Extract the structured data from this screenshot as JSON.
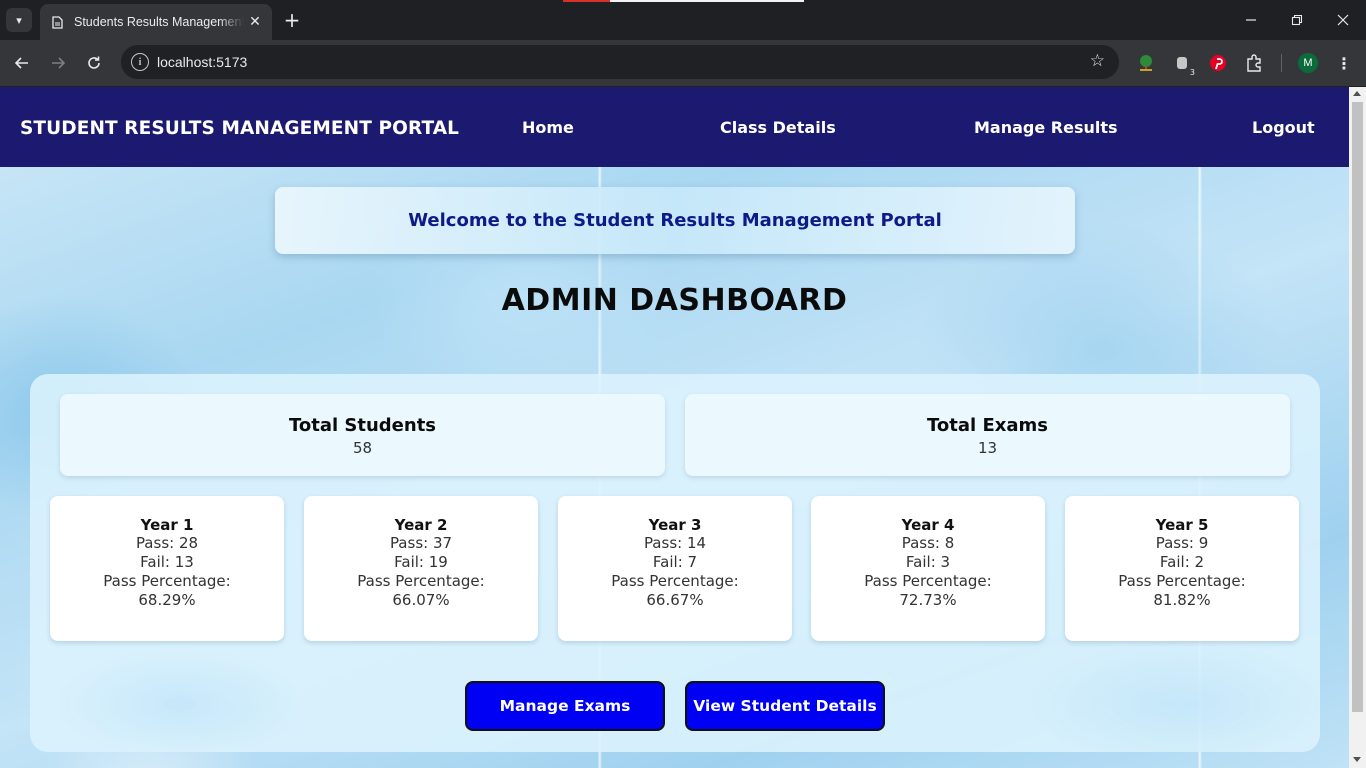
{
  "browser": {
    "tab_title": "Students Results Management Portal",
    "url": "localhost:5173",
    "profile_initial": "M",
    "extension_badge": "3"
  },
  "navbar": {
    "brand": "STUDENT RESULTS MANAGEMENT PORTAL",
    "links": [
      "Home",
      "Class Details",
      "Manage Results",
      "Logout"
    ]
  },
  "welcome": "Welcome to the Student Results Management Portal",
  "page_title": "ADMIN DASHBOARD",
  "stats": [
    {
      "label": "Total Students",
      "value": "58"
    },
    {
      "label": "Total Exams",
      "value": "13"
    }
  ],
  "years": [
    {
      "title": "Year 1",
      "pass": "Pass: 28",
      "fail": "Fail: 13",
      "pct_label": "Pass Percentage:",
      "pct": "68.29%"
    },
    {
      "title": "Year 2",
      "pass": "Pass: 37",
      "fail": "Fail: 19",
      "pct_label": "Pass Percentage:",
      "pct": "66.07%"
    },
    {
      "title": "Year 3",
      "pass": "Pass: 14",
      "fail": "Fail: 7",
      "pct_label": "Pass Percentage:",
      "pct": "66.67%"
    },
    {
      "title": "Year 4",
      "pass": "Pass: 8",
      "fail": "Fail: 3",
      "pct_label": "Pass Percentage:",
      "pct": "72.73%"
    },
    {
      "title": "Year 5",
      "pass": "Pass: 9",
      "fail": "Fail: 2",
      "pct_label": "Pass Percentage:",
      "pct": "81.82%"
    }
  ],
  "buttons": {
    "manage_exams": "Manage Exams",
    "view_students": "View Student Details"
  },
  "colors": {
    "navbar": "#1c1a70",
    "welcome_text": "#0d1a8a",
    "button": "#0000f5"
  }
}
